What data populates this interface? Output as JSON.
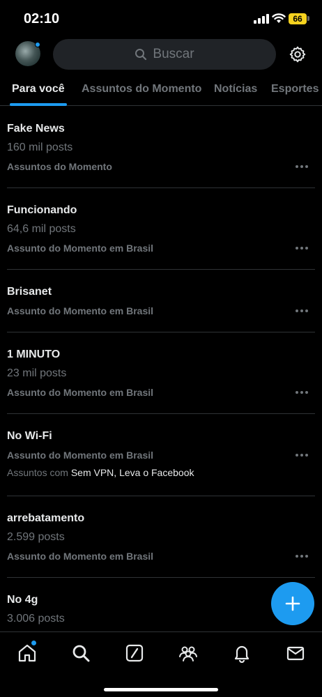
{
  "status_bar": {
    "time": "02:10",
    "battery": "66"
  },
  "header": {
    "search_placeholder": "Buscar"
  },
  "tabs": [
    "Para você",
    "Assuntos do Momento",
    "Notícias",
    "Esportes"
  ],
  "trends": [
    {
      "title": "Fake News",
      "posts": "160 mil posts",
      "category": "Assuntos do Momento"
    },
    {
      "title": "Funcionando",
      "posts": "64,6 mil posts",
      "category": "Assunto do Momento em Brasil"
    },
    {
      "title": "Brisanet",
      "category": "Assunto do Momento em Brasil"
    },
    {
      "title": "1 MINUTO",
      "posts": "23 mil posts",
      "category": "Assunto do Momento em Brasil"
    },
    {
      "title": "No Wi-Fi",
      "category": "Assunto do Momento em Brasil",
      "with_prefix": "Assuntos com",
      "with_topics": "Sem VPN, Leva o Facebook"
    },
    {
      "title": "arrebatamento",
      "posts": "2.599 posts",
      "category": "Assunto do Momento em Brasil"
    },
    {
      "title": "No 4g",
      "posts": "3.006 posts"
    }
  ],
  "bottom_nav": [
    "home-icon",
    "search-icon",
    "grok-icon",
    "communities-icon",
    "notifications-icon",
    "messages-icon"
  ],
  "colors": {
    "accent": "#1d9bf0",
    "background": "#000000",
    "muted_text": "#71767b",
    "battery": "#f5d21f"
  }
}
